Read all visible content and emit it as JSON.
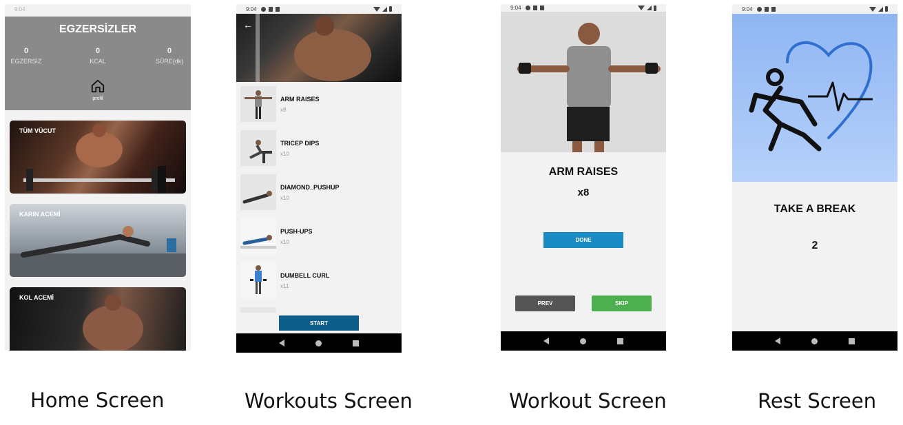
{
  "captions": {
    "home": "Home Screen",
    "workouts": "Workouts Screen",
    "workout": "Workout Screen",
    "rest": "Rest Screen"
  },
  "status_time": "9:04",
  "home": {
    "title": "EGZERSİZLER",
    "stats": [
      {
        "value": "0",
        "label": "EGZERSİZ"
      },
      {
        "value": "0",
        "label": "KCAL"
      },
      {
        "value": "0",
        "label": "SÜRE(dk)"
      }
    ],
    "profile_label": "profil",
    "cards": [
      {
        "label": "TÜM VÜCUT"
      },
      {
        "label": "KARIN ACEMİ"
      },
      {
        "label": "KOL ACEMİ"
      }
    ]
  },
  "workouts": {
    "back_icon": "arrow-left-icon",
    "items": [
      {
        "name": "ARM RAISES",
        "reps": "x8"
      },
      {
        "name": "TRICEP DIPS",
        "reps": "x10"
      },
      {
        "name": "DIAMOND_PUSHUP",
        "reps": "x10"
      },
      {
        "name": "PUSH-UPS",
        "reps": "x10"
      },
      {
        "name": "DUMBELL CURL",
        "reps": "x11"
      }
    ],
    "start_label": "START",
    "start_color": "#0d5d8a"
  },
  "workout": {
    "exercise": "ARM RAISES",
    "count": "x8",
    "done_label": "DONE",
    "prev_label": "PREV",
    "skip_label": "SKIP",
    "done_color": "#1a8cc3",
    "prev_color": "#555555",
    "skip_color": "#4caf50"
  },
  "rest": {
    "title": "TAKE A BREAK",
    "countdown": "2"
  }
}
